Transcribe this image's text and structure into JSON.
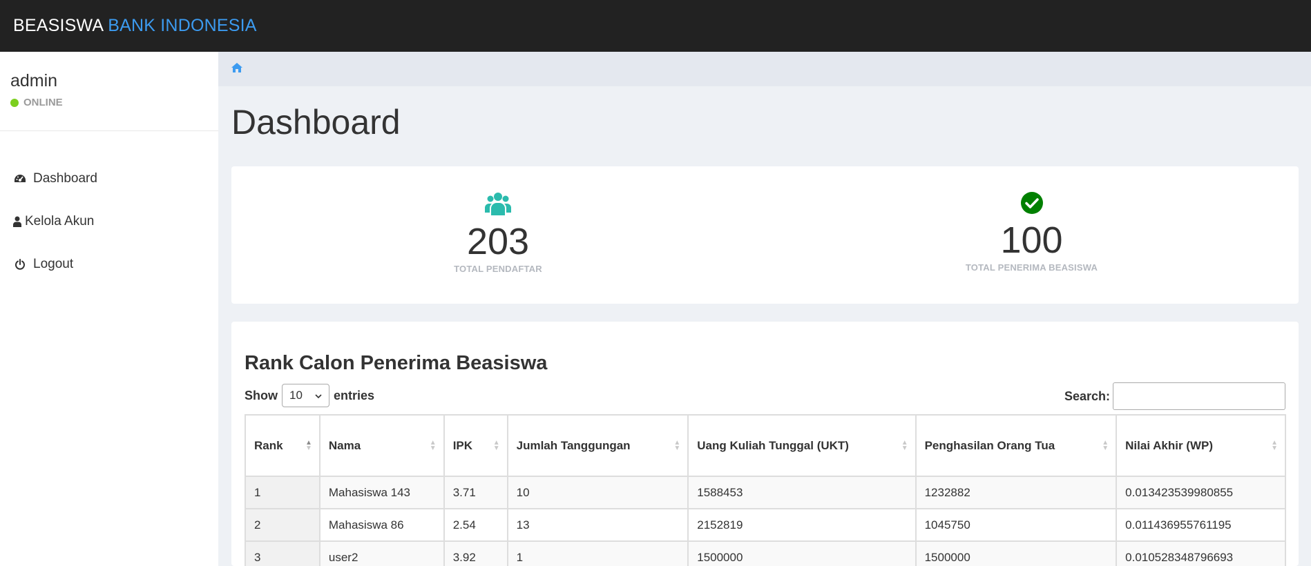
{
  "brand": {
    "part1": "BEASISWA",
    "part2": "BANK INDONESIA"
  },
  "user": {
    "name": "admin",
    "status": "ONLINE"
  },
  "menu": [
    {
      "label": "Dashboard",
      "icon": "dashboard-icon"
    },
    {
      "label": "Kelola Akun",
      "icon": "user-icon"
    },
    {
      "label": "Logout",
      "icon": "power-icon"
    }
  ],
  "breadcrumb": {
    "icon": "home-icon"
  },
  "page": {
    "title": "Dashboard"
  },
  "stats": [
    {
      "value": "203",
      "label": "TOTAL PENDAFTAR",
      "icon": "users-icon",
      "color": "#2bbbad"
    },
    {
      "value": "100",
      "label": "TOTAL PENERIMA BEASISWA",
      "icon": "check-circle-icon",
      "color": "#008000"
    }
  ],
  "ranking": {
    "title": "Rank Calon Penerima Beasiswa",
    "show_label": "Show",
    "entries_value": "10",
    "entries_label": "entries",
    "search_label": "Search:",
    "search_value": "",
    "columns": [
      "Rank",
      "Nama",
      "IPK",
      "Jumlah Tanggungan",
      "Uang Kuliah Tunggal (UKT)",
      "Penghasilan Orang Tua",
      "Nilai Akhir (WP)"
    ],
    "rows": [
      [
        "1",
        "Mahasiswa 143",
        "3.71",
        "10",
        "1588453",
        "1232882",
        "0.013423539980855"
      ],
      [
        "2",
        "Mahasiswa 86",
        "2.54",
        "13",
        "2152819",
        "1045750",
        "0.011436955761195"
      ],
      [
        "3",
        "user2",
        "3.92",
        "1",
        "1500000",
        "1500000",
        "0.010528348796693"
      ]
    ]
  },
  "colors": {
    "topbar": "#222222",
    "accent": "#3c9bf0",
    "online": "#7ccf1f"
  }
}
